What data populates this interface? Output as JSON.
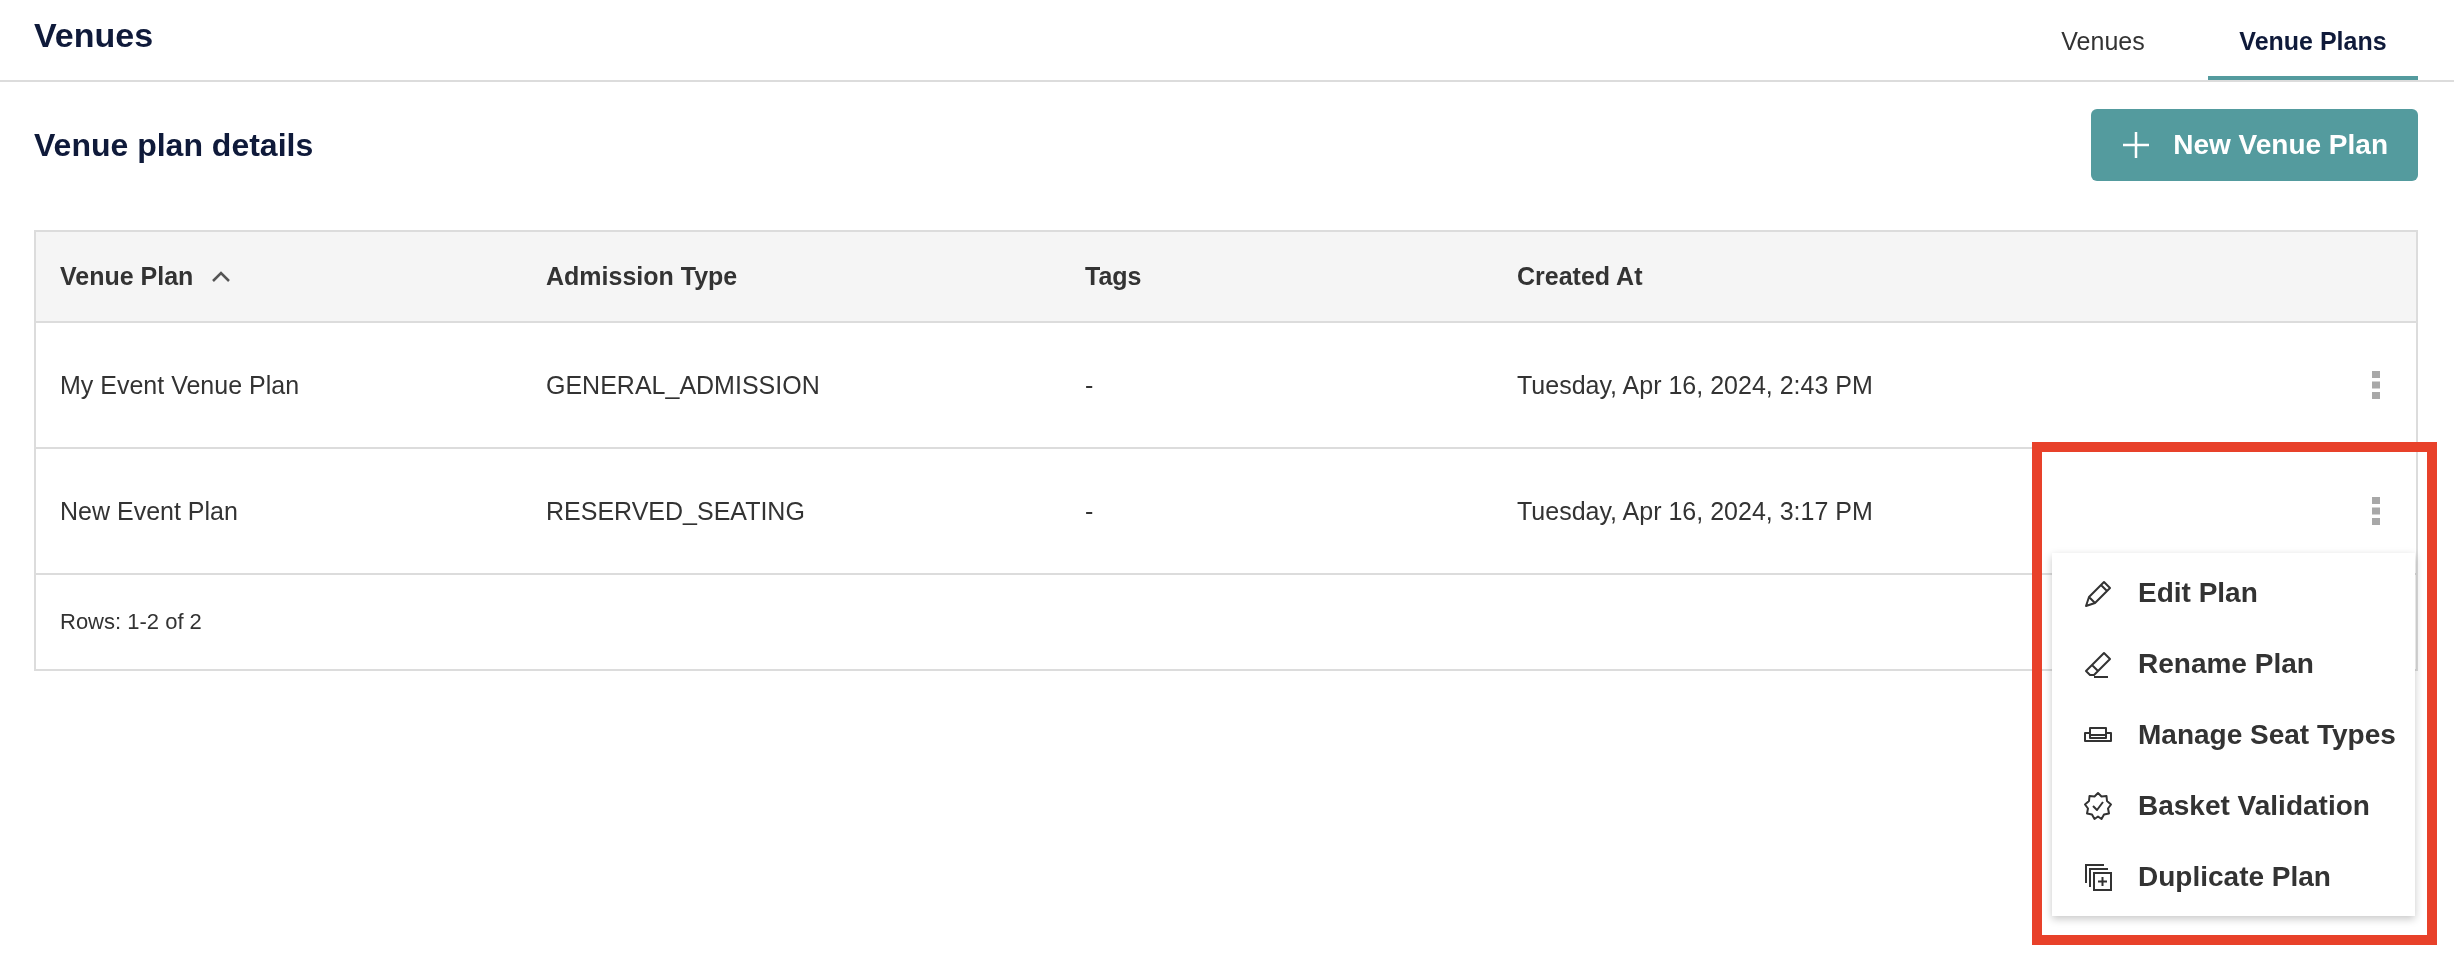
{
  "page": {
    "title": "Venues"
  },
  "tabs": [
    {
      "label": "Venues",
      "selected": false
    },
    {
      "label": "Venue Plans",
      "selected": true
    }
  ],
  "section": {
    "title": "Venue plan details",
    "new_button": "New Venue Plan"
  },
  "table": {
    "columns": [
      {
        "label": "Venue Plan",
        "sorted": true
      },
      {
        "label": "Admission Type",
        "sorted": false
      },
      {
        "label": "Tags",
        "sorted": false
      },
      {
        "label": "Created At",
        "sorted": false
      }
    ],
    "rows": [
      {
        "cells": [
          "My Event Venue Plan",
          "GENERAL_ADMISSION",
          "-",
          "Tuesday, Apr 16, 2024, 2:43 PM"
        ]
      },
      {
        "cells": [
          "New Event Plan",
          "RESERVED_SEATING",
          "-",
          "Tuesday, Apr 16, 2024, 3:17 PM"
        ]
      }
    ],
    "footer": "Rows: 1-2 of 2"
  },
  "context_menu": {
    "items": [
      {
        "label": "Edit Plan",
        "kind": "edit"
      },
      {
        "label": "Rename Plan",
        "kind": "rename"
      },
      {
        "label": "Manage Seat Types",
        "kind": "seats"
      },
      {
        "label": "Basket Validation",
        "kind": "validate"
      },
      {
        "label": "Duplicate Plan",
        "kind": "duplicate"
      }
    ]
  }
}
